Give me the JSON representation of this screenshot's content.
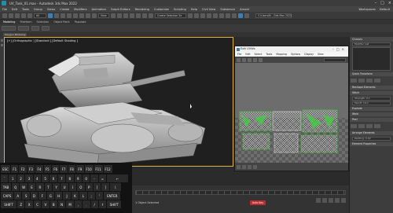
{
  "window": {
    "title": "UV_Tank_01.max - Autodesk 3ds Max 2022"
  },
  "menubar": {
    "items": [
      "File",
      "Edit",
      "Tools",
      "Group",
      "Views",
      "Create",
      "Modifiers",
      "Animation",
      "Graph Editors",
      "Rendering",
      "Customize",
      "Scripting",
      "Help",
      "Civil View",
      "Substance",
      "Arnold",
      "Workspaces"
    ],
    "workspace_value": "Default"
  },
  "toolbar": {
    "selection_set_placeholder": "Create Selection Se",
    "project_label": "C:\\Users\\B...\\3ds Max 2022"
  },
  "ribbon": {
    "tabs": [
      "Modeling",
      "Freeform",
      "Selection",
      "Object Paint",
      "Populate"
    ],
    "active_tab": "Modeling",
    "subrow_chips": [
      "Polygon Modeling"
    ]
  },
  "viewport": {
    "label": "[+] [Orthographic ] [Standard ] [Default Shading ]"
  },
  "uv_window": {
    "title": "Edit UVWs",
    "menu": [
      "File",
      "Edit",
      "Select",
      "Tools",
      "Mapping",
      "Options",
      "Display",
      "View"
    ],
    "dropdown_value": "Checker"
  },
  "command_panel": {
    "object_name": "Chassis",
    "modifier_list": "Modifier List",
    "rollouts": [
      "Quick Transform",
      "Reshape Elements",
      "Stitch",
      "Explode",
      "Weld",
      "Peel",
      "Arrange Elements",
      "Element Properties"
    ],
    "fields": [
      "Strength: 0.1",
      "Falloff: 16.0",
      "Padding: 0.02"
    ]
  },
  "keyboard": {
    "rows": [
      [
        "ESC",
        "F1",
        "F2",
        "F3",
        "F4",
        "F5",
        "F6",
        "F7",
        "F8",
        "F9",
        "F10",
        "F11",
        "F12"
      ],
      [
        "`",
        "1",
        "2",
        "3",
        "4",
        "5",
        "6",
        "7",
        "8",
        "9",
        "0",
        "-",
        "=",
        "←"
      ],
      [
        "TAB",
        "Q",
        "W",
        "E",
        "R",
        "T",
        "Y",
        "U",
        "I",
        "O",
        "P",
        "[",
        "]",
        "\\"
      ],
      [
        "CAPS",
        "A",
        "S",
        "D",
        "F",
        "G",
        "H",
        "J",
        "K",
        "L",
        ";",
        "'",
        "ENTER"
      ],
      [
        "SHIFT",
        "Z",
        "X",
        "C",
        "V",
        "B",
        "N",
        "M",
        ",",
        ".",
        "/",
        "↑",
        "SHIFT"
      ]
    ]
  },
  "timeline": {
    "status_text": "1 Object Selected",
    "autokey_label": "Auto Key"
  },
  "colors": {
    "viewport_border": "#e0b23a",
    "accent_blue": "#3d7fb5",
    "uv_green": "#3dd63d",
    "autokey_red": "#b82e2e"
  }
}
